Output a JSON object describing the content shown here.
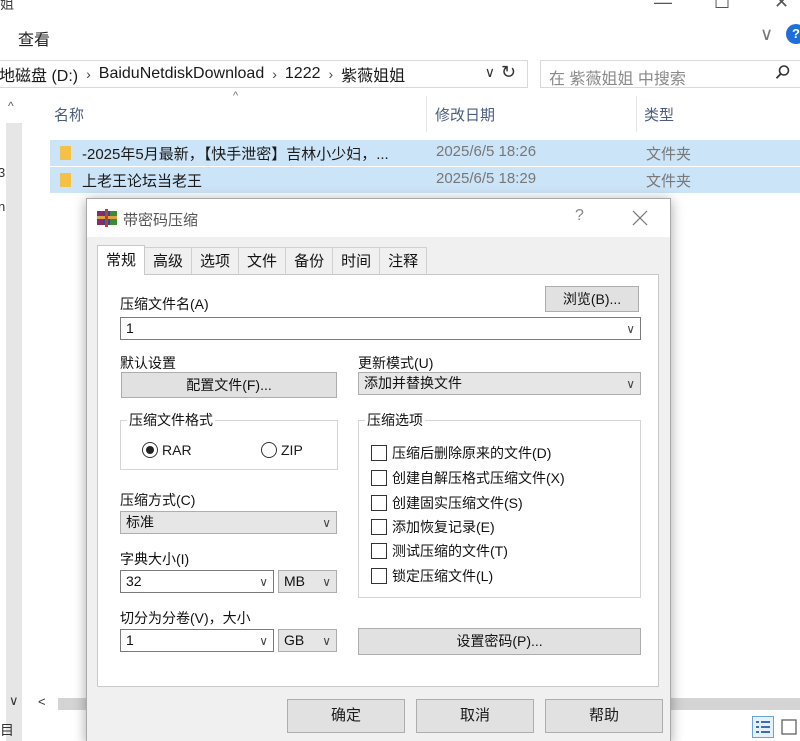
{
  "explorer": {
    "title_fragment": "姐",
    "ribbon_tab": "查看",
    "breadcrumb": {
      "drive": "地磁盘 (D:)",
      "folder1": "BaiduNetdiskDownload",
      "folder2": "1222",
      "folder3": "紫薇姐姐"
    },
    "search_placeholder": "在 紫薇姐姐 中搜索",
    "columns": {
      "name": "名称",
      "date": "修改日期",
      "type": "类型"
    },
    "files": [
      {
        "name": "-2025年5月最新，【快手泄密】吉林小少妇，...",
        "date": "2025/6/5 18:26",
        "type": "文件夹"
      },
      {
        "name": "上老王论坛当老王",
        "date": "2025/6/5 18:29",
        "type": "文件夹"
      }
    ],
    "left_fragments": [
      "3",
      "n"
    ],
    "status_fragment": "目"
  },
  "dialog": {
    "title": "带密码压缩",
    "help_glyph": "?",
    "tabs": [
      "常规",
      "高级",
      "选项",
      "文件",
      "备份",
      "时间",
      "注释"
    ],
    "archive_name_label": "压缩文件名(A)",
    "archive_name_value": "1",
    "browse_button": "浏览(B)...",
    "default_settings_label": "默认设置",
    "profiles_button": "配置文件(F)...",
    "update_mode_label": "更新模式(U)",
    "update_mode_value": "添加并替换文件",
    "format_group_label": "压缩文件格式",
    "format_rar": "RAR",
    "format_zip": "ZIP",
    "method_label": "压缩方式(C)",
    "method_value": "标准",
    "dict_label": "字典大小(I)",
    "dict_value": "32",
    "dict_unit": "MB",
    "split_label": "切分为分卷(V)，大小",
    "split_value": "1",
    "split_unit": "GB",
    "options_group_label": "压缩选项",
    "options": [
      "压缩后删除原来的文件(D)",
      "创建自解压格式压缩文件(X)",
      "创建固实压缩文件(S)",
      "添加恢复记录(E)",
      "测试压缩的文件(T)",
      "锁定压缩文件(L)"
    ],
    "set_password_button": "设置密码(P)...",
    "ok_button": "确定",
    "cancel_button": "取消",
    "help_button": "帮助"
  },
  "colors": {
    "selection": "#cce4f7",
    "dialog_bg": "#f0f0f0",
    "folder": "#f4c146",
    "header_text": "#4a5d7e"
  }
}
